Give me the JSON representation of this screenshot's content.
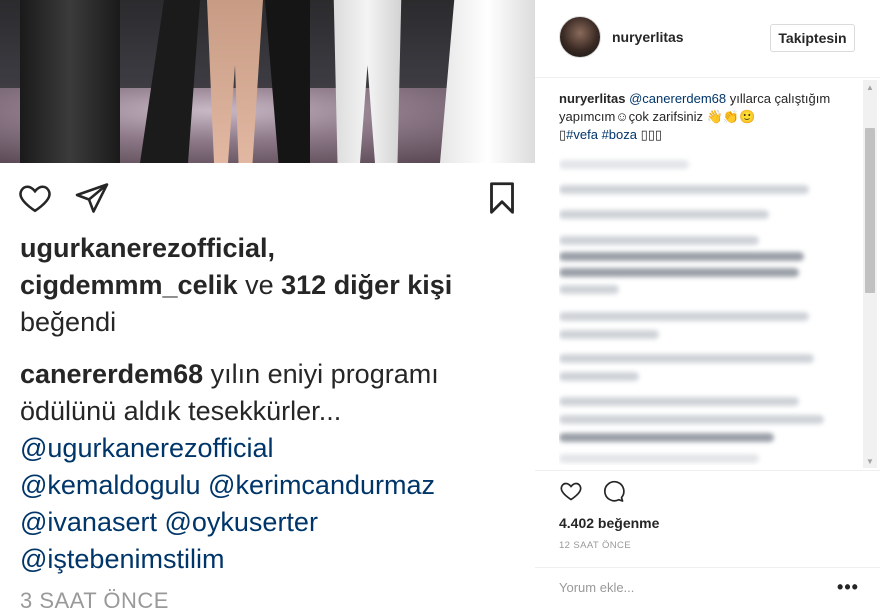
{
  "left_post": {
    "likes": {
      "user1": "ugurkanerezofficial,",
      "user2": "cigdemmm_celik",
      "connector": " ve ",
      "others": "312 diğer kişi",
      "suffix": "beğendi"
    },
    "caption": {
      "username": "canererdem68",
      "text_line1": " yılın eniyi programı",
      "text_line2": "ödülünü aldık tesekkürler...",
      "mentions": [
        "@ugurkanerezofficial",
        "@kemaldogulu",
        "@kerimcandurmaz",
        "@ivanasert",
        "@oykuserter",
        "@iştebenimstilim"
      ]
    },
    "time": "3 SAAT ÖNCE",
    "icons": {
      "like": "heart-icon",
      "share": "send-icon",
      "save": "bookmark-icon"
    }
  },
  "right_panel": {
    "header": {
      "username": "nuryerlitas",
      "follow_label": "Takiptesin"
    },
    "caption": {
      "username": "nuryerlitas",
      "mention": "@canererdem68",
      "text1": " yıllarca çalıştığım yapımcım☺çok zarifsiniz 👋👏🙂",
      "hashtags": "#vefa #boza",
      "prefix_box": "▯",
      "suffix_boxes": "▯▯▯"
    },
    "likes_count": "4.402 beğenme",
    "time": "12 SAAT ÖNCE",
    "comment_placeholder": "Yorum ekle...",
    "more_label": "•••",
    "icons": {
      "like": "heart-icon",
      "comment": "comment-icon",
      "more": "more-options-icon",
      "scroll_up": "scroll-up-arrow-icon",
      "scroll_down": "scroll-down-arrow-icon"
    }
  }
}
